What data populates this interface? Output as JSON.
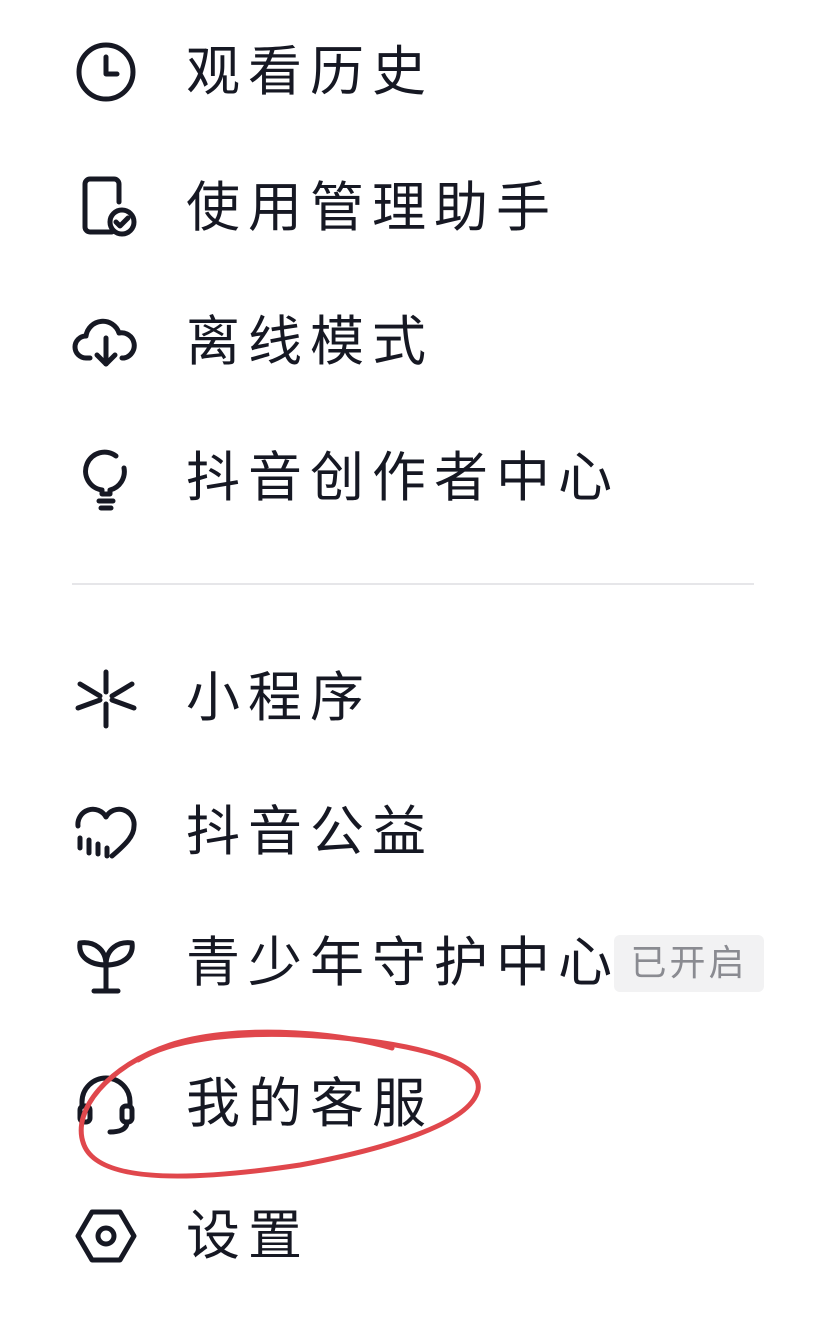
{
  "menu_section_1": {
    "items": [
      {
        "label": "观看历史",
        "icon": "clock-icon"
      },
      {
        "label": "使用管理助手",
        "icon": "phone-check-icon"
      },
      {
        "label": "离线模式",
        "icon": "cloud-download-icon"
      },
      {
        "label": "抖音创作者中心",
        "icon": "lightbulb-icon"
      }
    ]
  },
  "menu_section_2": {
    "items": [
      {
        "label": "小程序",
        "icon": "mini-program-icon"
      },
      {
        "label": "抖音公益",
        "icon": "heart-chart-icon"
      },
      {
        "label": "青少年守护中心",
        "icon": "sprout-icon",
        "badge": "已开启"
      },
      {
        "label": "我的客服",
        "icon": "headset-icon"
      },
      {
        "label": "设置",
        "icon": "hexagon-settings-icon"
      }
    ]
  },
  "colors": {
    "text": "#161823",
    "icon": "#161823",
    "divider": "#e6e6e9",
    "badge_bg": "#f2f2f3",
    "badge_text": "#8a8b91",
    "annotation_stroke": "#e0474c"
  }
}
